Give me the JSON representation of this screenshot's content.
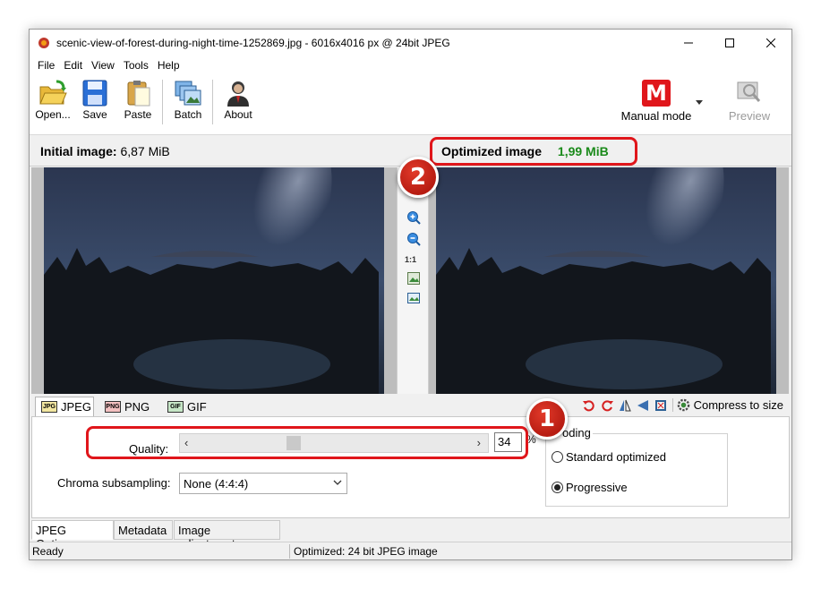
{
  "window": {
    "title": "scenic-view-of-forest-during-night-time-1252869.jpg - 6016x4016 px @ 24bit JPEG"
  },
  "menu": [
    "File",
    "Edit",
    "View",
    "Tools",
    "Help"
  ],
  "toolbar": {
    "open_label": "Open...",
    "save_label": "Save",
    "paste_label": "Paste",
    "batch_label": "Batch",
    "about_label": "About",
    "mode_label": "Manual mode",
    "mode_icon_letter": "M",
    "preview_label": "Preview"
  },
  "sizes": {
    "initial_label": "Initial image:",
    "initial_value": "6,87 MiB",
    "optimized_label": "Optimized image",
    "optimized_value": "1,99 MiB"
  },
  "annotations": {
    "badge_1": "1",
    "badge_2": "2"
  },
  "zoom": {
    "one_to_one": "1:1"
  },
  "format_tabs": {
    "jpeg": "JPEG",
    "png": "PNG",
    "gif": "GIF",
    "jpeg_icon_text": "JPG",
    "png_icon_text": "PNG",
    "gif_icon_text": "GIF"
  },
  "compress_label": "Compress to size",
  "options": {
    "quality_label": "Quality:",
    "quality_value": "34",
    "quality_fraction": 0.34,
    "percent": "%",
    "chroma_label": "Chroma subsampling:",
    "chroma_value": "None (4:4:4)",
    "coding_title": "oding",
    "coding_options": [
      "Standard optimized",
      "Progressive"
    ],
    "coding_selected": "Progressive"
  },
  "bottom_tabs": [
    "JPEG Options",
    "Metadata",
    "Image adjustments"
  ],
  "status": {
    "left": "Ready",
    "right": "Optimized: 24 bit JPEG image"
  },
  "colors": {
    "highlight_red": "#e0161b",
    "optimized_green": "#1a8a1a",
    "mode_red": "#e0161b"
  }
}
